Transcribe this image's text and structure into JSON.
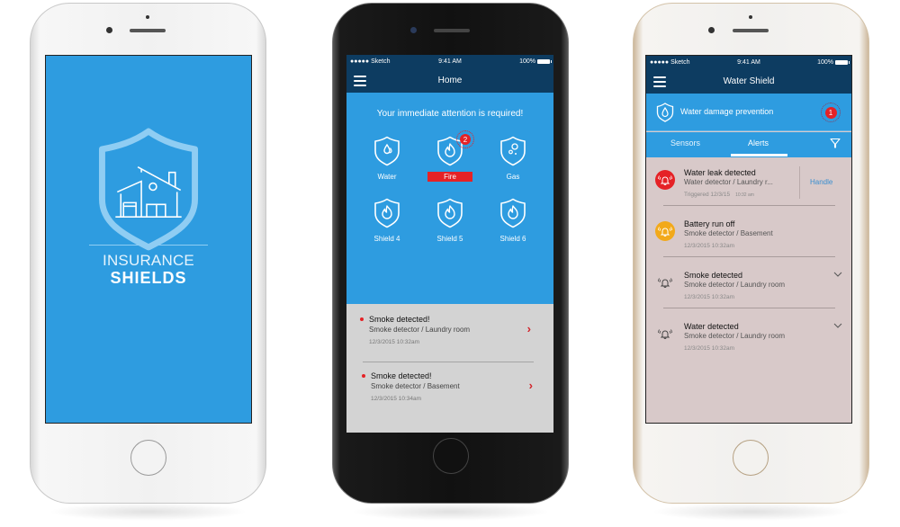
{
  "colors": {
    "primary_blue": "#2e9ce0",
    "navbar_navy": "#0d3c61",
    "alert_red": "#e52226",
    "warning_amber": "#f2a91a",
    "list_gray": "#d3d3d3",
    "list_mauve": "#d8c9c9",
    "link_blue": "#3a8fd0"
  },
  "splash": {
    "logo_icon": "shield-house-icon",
    "title_line1": "INSURANCE",
    "title_line2": "SHIELDS"
  },
  "home": {
    "status": {
      "carrier": "●●●●● Sketch",
      "wifi_icon": "wifi-icon",
      "time": "9:41 AM",
      "battery": "100%"
    },
    "nav": {
      "menu_icon": "hamburger-menu-icon",
      "title": "Home"
    },
    "attention_text": "Your immediate attention is required!",
    "shields": [
      {
        "label": "Water",
        "icon": "water-shield-icon",
        "active": false,
        "badge": null
      },
      {
        "label": "Fire",
        "icon": "fire-shield-icon",
        "active": true,
        "badge": "2"
      },
      {
        "label": "Gas",
        "icon": "gas-shield-icon",
        "active": false,
        "badge": null
      },
      {
        "label": "Shield 4",
        "icon": "fire-shield-icon",
        "active": false,
        "badge": null
      },
      {
        "label": "Shield 5",
        "icon": "fire-shield-icon",
        "active": false,
        "badge": null
      },
      {
        "label": "Shield 6",
        "icon": "fire-shield-icon",
        "active": false,
        "badge": null
      }
    ],
    "alerts": [
      {
        "title": "Smoke detected!",
        "subtitle": "Smoke detector / Laundry room",
        "time": "12/3/2015 10:32am"
      },
      {
        "title": "Smoke detected!",
        "subtitle": "Smoke detector / Basement",
        "time": "12/3/2015 10:34am"
      }
    ]
  },
  "water_shield": {
    "status": {
      "carrier": "●●●●● Sketch",
      "wifi_icon": "wifi-icon",
      "time": "9:41 AM",
      "battery": "100%"
    },
    "nav": {
      "menu_icon": "hamburger-menu-icon",
      "title": "Water Shield"
    },
    "banner": {
      "title": "Water damage prevention",
      "badge": "1"
    },
    "tabs": [
      {
        "label": "Sensors",
        "active": false
      },
      {
        "label": "Alerts",
        "active": true
      }
    ],
    "filter_icon": "filter-icon",
    "alerts": [
      {
        "title": "Water leak detected",
        "subtitle": "Water detector / Laundry r...",
        "date": "Triggered 12/3/15",
        "time_small": "10:32 am",
        "severity": "critical",
        "action": "Handle"
      },
      {
        "title": "Battery run off",
        "subtitle": "Smoke detector / Basement",
        "date": "12/3/2015 10:32am",
        "severity": "warning"
      },
      {
        "title": "Smoke detected",
        "subtitle": "Smoke detector / Laundry room",
        "date": "12/3/2015 10:32am",
        "severity": "normal"
      },
      {
        "title": "Water detected",
        "subtitle": "Smoke detector / Laundry room",
        "date": "12/3/2015 10:32am",
        "severity": "normal"
      }
    ]
  }
}
